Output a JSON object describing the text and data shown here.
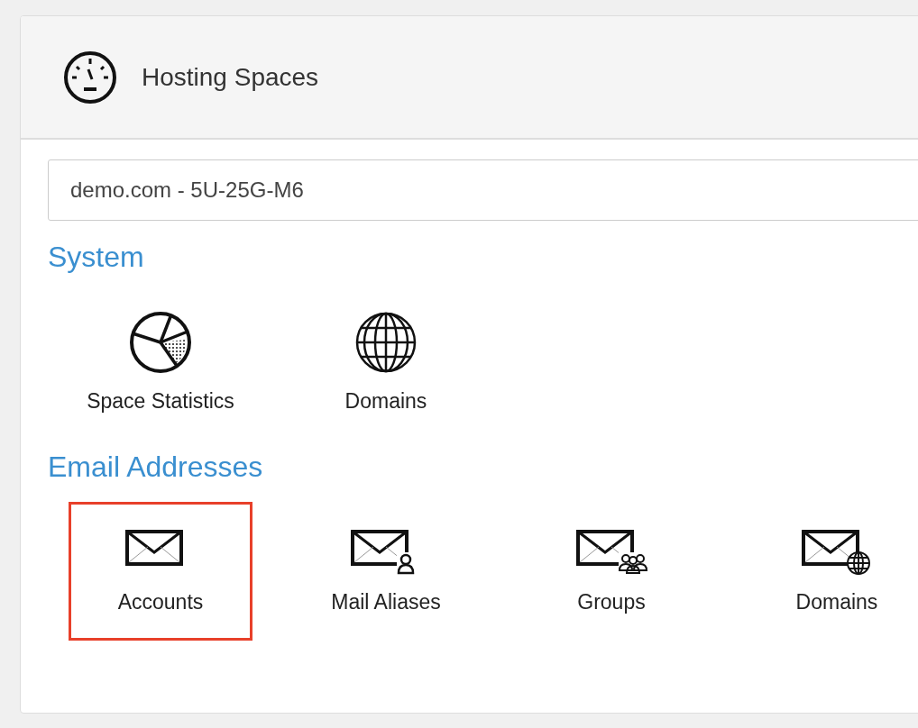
{
  "panel": {
    "title": "Hosting Spaces"
  },
  "space_select": {
    "value": "demo.com - 5U-25G-M6"
  },
  "sections": [
    {
      "heading": "System",
      "items": [
        {
          "label": "Space Statistics",
          "selected": false
        },
        {
          "label": "Domains",
          "selected": false
        }
      ]
    },
    {
      "heading": "Email Addresses",
      "items": [
        {
          "label": "Accounts",
          "selected": true
        },
        {
          "label": "Mail Aliases",
          "selected": false
        },
        {
          "label": "Groups",
          "selected": false
        },
        {
          "label": "Domains",
          "selected": false
        }
      ]
    }
  ]
}
